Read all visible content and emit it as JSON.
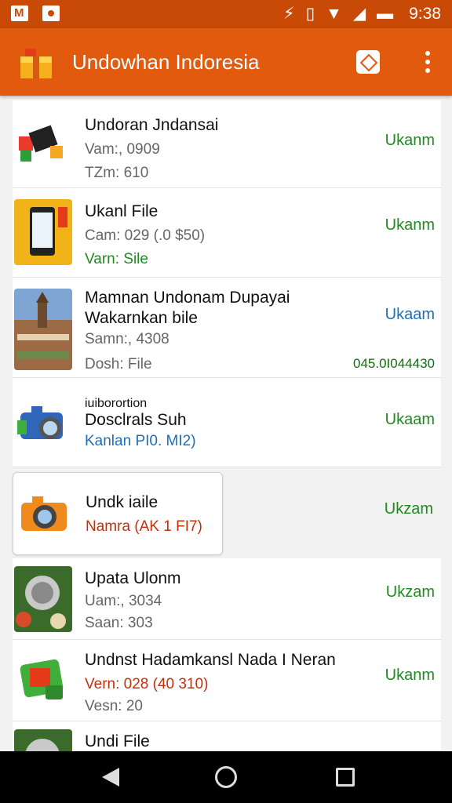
{
  "status_bar": {
    "time": "9:38",
    "left_icons": [
      "gmail-icon",
      "notification-icon"
    ],
    "right_icons": [
      "nfc-icon",
      "vibrate-icon",
      "wifi-icon",
      "signal-icon",
      "battery-icon"
    ]
  },
  "app_bar": {
    "title": "Undowhan Indoresia",
    "logo_icon": "gift-box-icon",
    "actions": [
      "diamond-icon",
      "more-vert-icon"
    ],
    "color": "#e25a0e"
  },
  "items": [
    {
      "title": "Undoran Jndansai",
      "line2": "Vam:, 0909",
      "line3": "TZm: 610",
      "action": "Ukanm",
      "icon": "cubes-icon"
    },
    {
      "title": "Ukanl File",
      "line2": "Cam: 029 (.0 $50)",
      "line3": "Varn: Sile",
      "action": "Ukanm",
      "icon": "phone-icon"
    },
    {
      "title": "Mamnan Undonam Dupayai",
      "line2": "Wakarnkan bile",
      "line3": "Samn:, 4308",
      "line4": "Dosh: File",
      "action": "Ukaam",
      "extra": "045.0I044430",
      "icon": "building-photo"
    },
    {
      "title_small": "iuiborortion",
      "title": "Dosclrals Suh",
      "line3": "Kanlan PI0. MI2)",
      "action": "Ukaam",
      "icon": "camera-icon"
    },
    {
      "title": "Undk iaile",
      "line2": "Namra (AK 1 FI7)",
      "action": "Ukzam",
      "icon": "camera-icon"
    },
    {
      "title": "Upata Ulonm",
      "line2": "Uam:, 3034",
      "line3": "Saan: 303",
      "action": "Ukzam",
      "icon": "food-photo"
    },
    {
      "title": "Undnst Hadamkansl Nada I Neran",
      "line2": "Vern: 028 (40 310)",
      "line3": "Vesn: 20",
      "action": "Ukanm",
      "icon": "card-icon"
    },
    {
      "title": "Undi File",
      "action": "",
      "icon": "food-photo"
    }
  ]
}
